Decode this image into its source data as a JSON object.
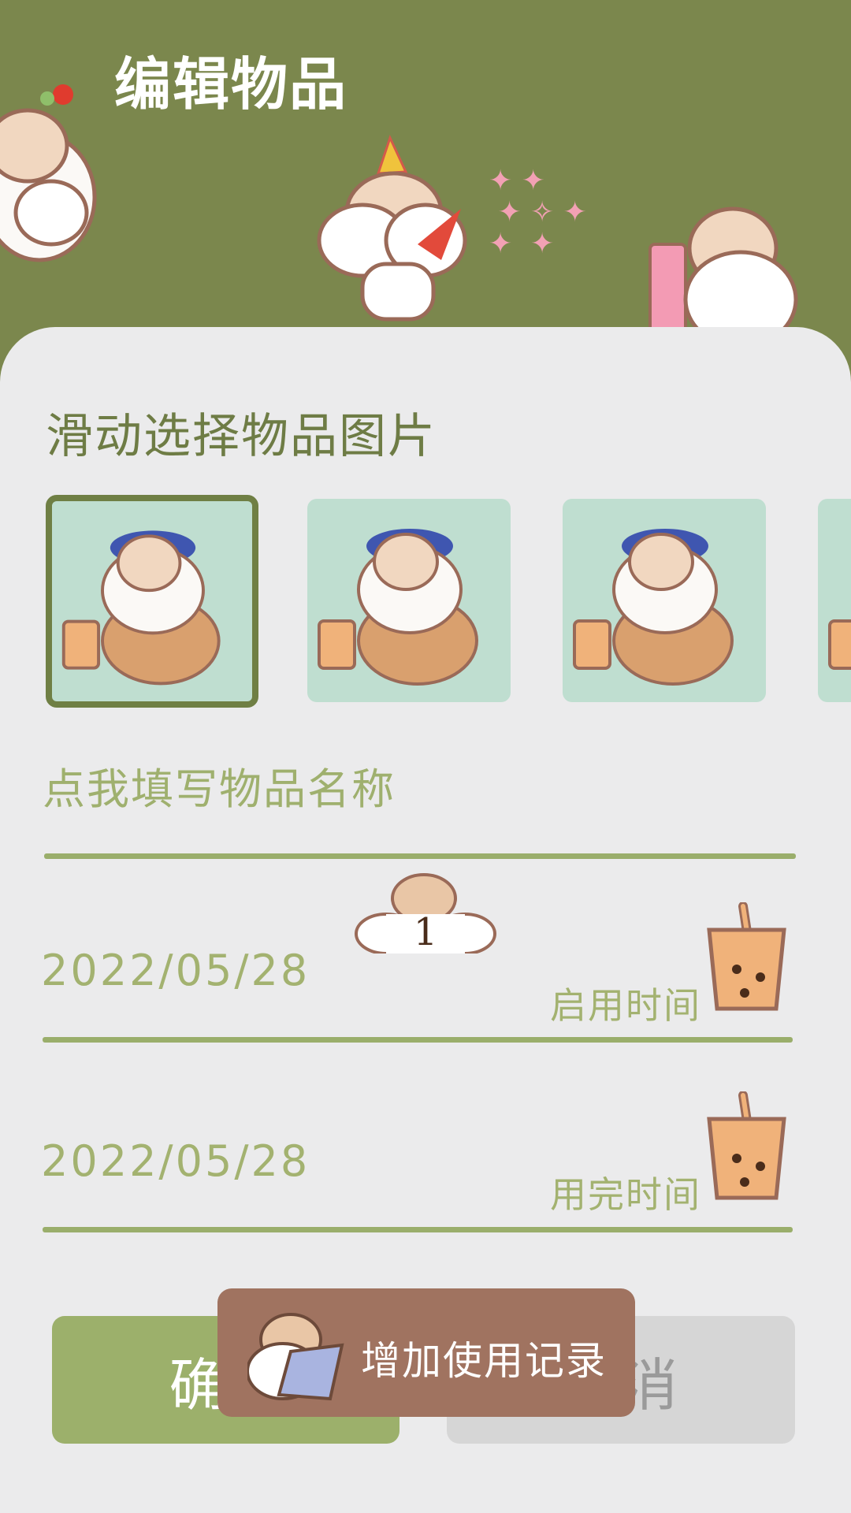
{
  "header": {
    "title": "编辑物品"
  },
  "picker": {
    "title": "滑动选择物品图片",
    "items": [
      {
        "icon": "hamster-boba-icon",
        "selected": true
      },
      {
        "icon": "hamster-boba-icon",
        "selected": false
      },
      {
        "icon": "hamster-boba-icon",
        "selected": false
      },
      {
        "icon": "hamster-boba-icon",
        "selected": false
      }
    ]
  },
  "name_field": {
    "placeholder": "点我填写物品名称"
  },
  "usage_badge": {
    "count": "1"
  },
  "start_date": {
    "value": "2022/05/28",
    "label": "启用时间"
  },
  "end_date": {
    "value": "2022/05/28",
    "label": "用完时间"
  },
  "buttons": {
    "confirm": "确认",
    "cancel": "取消"
  },
  "toast": {
    "text": "增加使用记录"
  },
  "colors": {
    "header": "#7b874d",
    "accent": "#9cb06b",
    "toast": "#a07360"
  }
}
